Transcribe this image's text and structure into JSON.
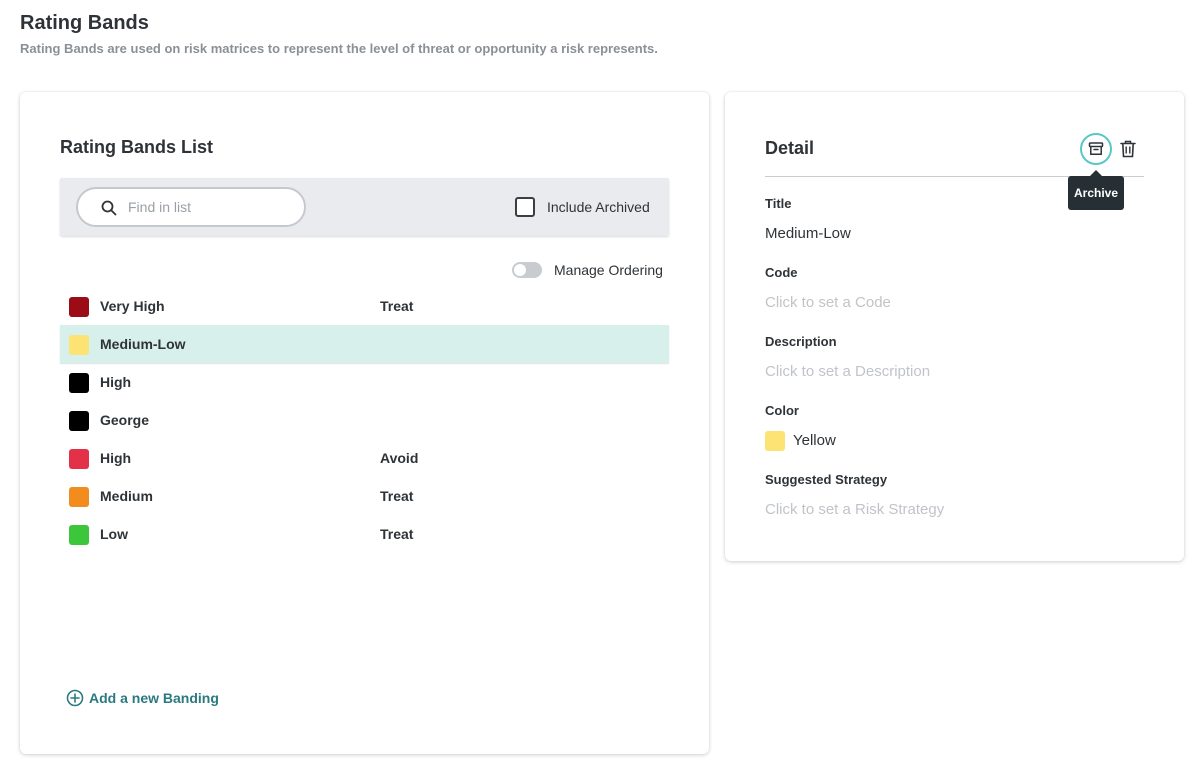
{
  "page": {
    "title": "Rating Bands",
    "subtitle": "Rating Bands are used on risk matrices to represent the level of threat or opportunity a risk represents."
  },
  "list": {
    "title": "Rating Bands List",
    "search_placeholder": "Find in list",
    "search_value": "",
    "include_archived_label": "Include Archived",
    "include_archived_checked": false,
    "manage_ordering_label": "Manage Ordering",
    "manage_ordering_on": false,
    "items": [
      {
        "title": "Very High",
        "strategy": "Treat",
        "color": "#9b0c16",
        "selected": false
      },
      {
        "title": "Medium-Low",
        "strategy": "",
        "color": "#fde274",
        "selected": true
      },
      {
        "title": "High",
        "strategy": "",
        "color": "#000000",
        "selected": false
      },
      {
        "title": "George",
        "strategy": "",
        "color": "#000000",
        "selected": false
      },
      {
        "title": "High",
        "strategy": "Avoid",
        "color": "#e33148",
        "selected": false
      },
      {
        "title": "Medium",
        "strategy": "Treat",
        "color": "#f28c1e",
        "selected": false
      },
      {
        "title": "Low",
        "strategy": "Treat",
        "color": "#3cc63c",
        "selected": false
      }
    ],
    "add_label": "Add a new Banding"
  },
  "detail": {
    "title": "Detail",
    "archive_tooltip": "Archive",
    "icons": {
      "archive": "archive-icon",
      "delete": "trash-icon"
    },
    "title_label": "Title",
    "title_value": "Medium-Low",
    "code_label": "Code",
    "code_placeholder": "Click to set a Code",
    "description_label": "Description",
    "description_placeholder": "Click to set a Description",
    "color_label": "Color",
    "color_value": "Yellow",
    "color_hex": "#fde274",
    "strategy_label": "Suggested Strategy",
    "strategy_placeholder": "Click to set a Risk Strategy"
  },
  "colors": {
    "accent": "#2a7a80",
    "selected_row": "#d8f0ec",
    "archive_ring": "#5cc6c6"
  }
}
